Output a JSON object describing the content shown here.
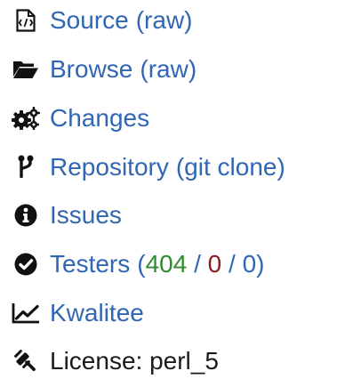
{
  "links": {
    "source": {
      "label": "Source",
      "extra": "(raw)",
      "icon": "source-code-file-icon"
    },
    "browse": {
      "label": "Browse",
      "extra": "(raw)",
      "icon": "folder-open-icon"
    },
    "changes": {
      "label": "Changes",
      "icon": "gears-icon"
    },
    "repository": {
      "label": "Repository",
      "extra": "(git clone)",
      "icon": "code-branch-icon"
    },
    "issues": {
      "label": "Issues",
      "icon": "info-circle-icon"
    },
    "testers": {
      "label": "Testers",
      "open": "(",
      "pass": "404",
      "sep1": " / ",
      "fail": "0",
      "sep2": " / ",
      "na": "0",
      "close": ")",
      "icon": "check-circle-icon",
      "colors": {
        "pass": "#2e8b2e",
        "fail": "#8b1c1c",
        "na": "#3166b4"
      }
    },
    "kwalitee": {
      "label": "Kwalitee",
      "icon": "line-chart-icon"
    },
    "license": {
      "label": "License: perl_5",
      "icon": "gavel-icon"
    }
  },
  "colors": {
    "link": "#3166b4",
    "text": "#1a1a1a",
    "icon": "#111111"
  }
}
